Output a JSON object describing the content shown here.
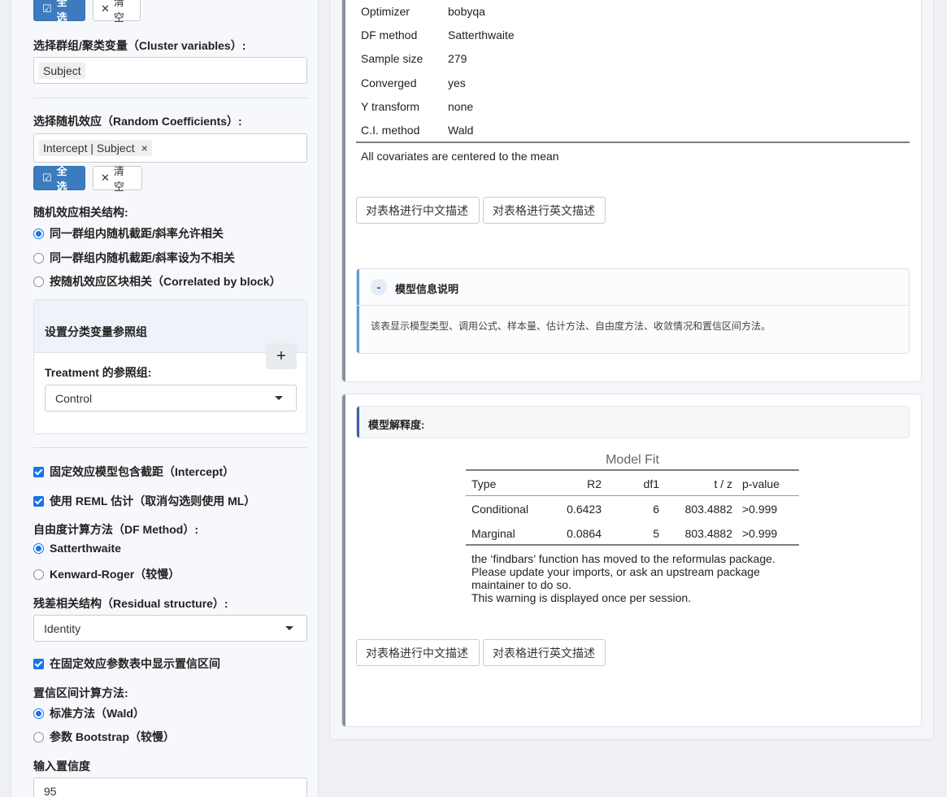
{
  "left": {
    "select_all": "全选",
    "clear": "清空",
    "cluster_label": "选择群组/聚类变量（Cluster variables）:",
    "cluster_value": "Subject",
    "random_label": "选择随机效应（Random Coefficients）:",
    "random_value": "Intercept | Subject",
    "corr_label": "随机效应相关结构:",
    "corr_options": [
      "同一群组内随机截距/斜率允许相关",
      "同一群组内随机截距/斜率设为不相关",
      "按随机效应区块相关（Correlated by block）"
    ],
    "ref_title": "设置分类变量参照组",
    "ref_plus": "+",
    "ref_label": "Treatment 的参照组:",
    "ref_value": "Control",
    "intercept_check": "固定效应模型包含截距（Intercept）",
    "reml_check": "使用 REML 估计（取消勾选则使用 ML）",
    "df_label": "自由度计算方法（DF Method）:",
    "df_options": [
      "Satterthwaite",
      "Kenward-Roger（较慢）"
    ],
    "resid_label": "残差相关结构（Residual structure）:",
    "resid_value": "Identity",
    "ci_check": "在固定效应参数表中显示置信区间",
    "ci_method_label": "置信区间计算方法:",
    "ci_options": [
      "标准方法（Wald）",
      "参数 Bootstrap（较慢）"
    ],
    "conf_label": "输入置信度",
    "conf_value": "95"
  },
  "model_info": {
    "rows": [
      {
        "k": "Optimizer",
        "v": "bobyqa"
      },
      {
        "k": "DF method",
        "v": "Satterthwaite"
      },
      {
        "k": "Sample size",
        "v": "279"
      },
      {
        "k": "Converged",
        "v": "yes"
      },
      {
        "k": "Y transform",
        "v": "none"
      },
      {
        "k": "C.I. method",
        "v": "Wald"
      }
    ],
    "footnote": "All covariates are centered to the mean",
    "btn_cn": "对表格进行中文描述",
    "btn_en": "对表格进行英文描述",
    "info_toggle": "-",
    "info_title": "模型信息说明",
    "info_text": "该表显示模型类型、调用公式、样本量、估计方法、自由度方法、收敛情况和置信区间方法。"
  },
  "model_fit": {
    "section_title": "模型解释度:",
    "caption": "Model Fit",
    "headers": [
      "Type",
      "R2",
      "df1",
      "t / z",
      "p-value"
    ],
    "rows": [
      [
        "Conditional",
        "0.6423",
        "6",
        "803.4882",
        ">0.999"
      ],
      [
        "Marginal",
        "0.0864",
        "5",
        "803.4882",
        ">0.999"
      ]
    ],
    "note_lines": [
      "the ‘findbars’ function has moved to the reformulas package.",
      "Please update your imports, or ask an upstream package",
      "maintainer to do so.",
      "This warning is displayed once per session."
    ],
    "btn_cn": "对表格进行中文描述",
    "btn_en": "对表格进行英文描述"
  },
  "colors": {
    "primary": "#3c7bbd",
    "radio": "#1a73e8",
    "info_accent": "#5b9bd5",
    "fit_accent": "#3c5ea8"
  }
}
